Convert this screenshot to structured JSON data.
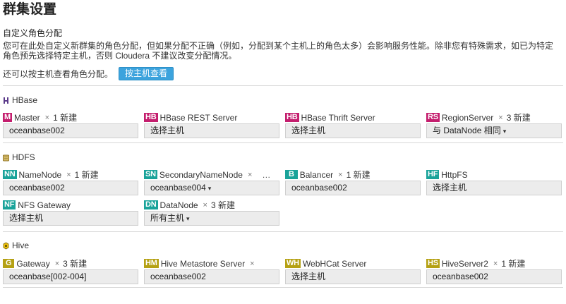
{
  "page": {
    "title": "群集设置",
    "subtitle": "自定义角色分配",
    "description": "您可在此处自定义新群集的角色分配，但如果分配不正确（例如，分配到某个主机上的角色太多）会影响服务性能。除非您有特殊需求，如已为特定角色预先选择特定主机，否则 Cloudera 不建议改变分配情况。",
    "host_hint": "还可以按主机查看角色分配。",
    "host_button": "按主机查看"
  },
  "colors": {
    "magenta": "#c41e6e",
    "teal": "#1aa39a",
    "olive": "#b5a114",
    "button": "#3ca3dd"
  },
  "services": [
    {
      "name": "HBase",
      "icon": "hbase-icon",
      "roles": [
        {
          "badge": "M",
          "name": "Master",
          "times": "×",
          "count": "1 新建",
          "value": "oceanbase002",
          "dropdown": false
        },
        {
          "badge": "HB",
          "name": "HBase REST Server",
          "value": "选择主机",
          "dropdown": false
        },
        {
          "badge": "HB",
          "name": "HBase Thrift Server",
          "value": "选择主机",
          "dropdown": false
        },
        {
          "badge": "RS",
          "name": "RegionServer",
          "times": "×",
          "count": "3 新建",
          "value": "与 DataNode 相同",
          "dropdown": true
        }
      ]
    },
    {
      "name": "HDFS",
      "icon": "hdfs-icon",
      "roles": [
        {
          "badge": "NN",
          "name": "NameNode",
          "times": "×",
          "count": "1 新建",
          "value": "oceanbase002",
          "dropdown": false
        },
        {
          "badge": "SN",
          "name": "SecondaryNameNode",
          "times": "×",
          "ellipsis": "…",
          "value": "oceanbase004",
          "dropdown": true
        },
        {
          "badge": "B",
          "name": "Balancer",
          "times": "×",
          "count": "1 新建",
          "value": "oceanbase002",
          "dropdown": false
        },
        {
          "badge": "HF",
          "name": "HttpFS",
          "value": "选择主机",
          "dropdown": false
        },
        {
          "badge": "NF",
          "name": "NFS Gateway",
          "value": "选择主机",
          "dropdown": false
        },
        {
          "badge": "DN",
          "name": "DataNode",
          "times": "×",
          "count": "3 新建",
          "value": "所有主机",
          "dropdown": true
        }
      ]
    },
    {
      "name": "Hive",
      "icon": "hive-icon",
      "roles": [
        {
          "badge": "G",
          "name": "Gateway",
          "times": "×",
          "count": "3 新建",
          "value": "oceanbase[002-004]",
          "dropdown": false
        },
        {
          "badge": "HM",
          "name": "Hive Metastore Server",
          "times": "×",
          "value": "oceanbase002",
          "dropdown": false
        },
        {
          "badge": "WH",
          "name": "WebHCat Server",
          "value": "选择主机",
          "dropdown": false
        },
        {
          "badge": "HS",
          "name": "HiveServer2",
          "times": "×",
          "count": "1 新建",
          "value": "oceanbase002",
          "dropdown": false
        }
      ]
    }
  ],
  "caret": "▾"
}
